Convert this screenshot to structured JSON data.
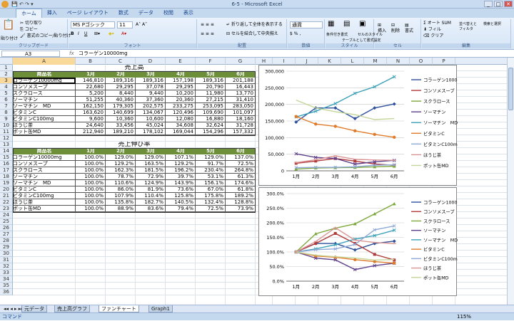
{
  "window": {
    "title": "6-5 - Microsoft Excel"
  },
  "ribbon_tabs": [
    "ホーム",
    "挿入",
    "ページ レイアウト",
    "数式",
    "データ",
    "校閲",
    "表示"
  ],
  "ribbon": {
    "paste": "貼り付け",
    "cut": "切り取り",
    "copy": "コピー",
    "format_painter": "書式のコピー/貼り付け",
    "font_name": "MS Pゴシック",
    "font_size": "11",
    "number_format": "通貨",
    "wrap": "折り返して全体を表示する",
    "merge": "セルを結合して中央揃え",
    "cond_format": "条件付き書式",
    "table_format": "テーブルとして書式設定",
    "cell_style": "セルのスタイル",
    "insert": "挿入",
    "delete": "削除",
    "format": "書式",
    "autosum": "オート SUM",
    "fill": "フィル",
    "clear": "クリア",
    "sort": "並べ替えとフィルタ",
    "find": "検索と選択",
    "groups": [
      "クリップボード",
      "フォント",
      "配置",
      "数値",
      "スタイル",
      "セル",
      "編集"
    ]
  },
  "formula_bar": {
    "name_box": "A3",
    "fx": "fx",
    "formula": "コラーゲン10000mg"
  },
  "columns": [
    "A",
    "B",
    "C",
    "D",
    "E",
    "F",
    "G",
    "H",
    "I",
    "J",
    "K",
    "L",
    "M",
    "N",
    "O",
    "P"
  ],
  "rows": [
    "1",
    "2",
    "3",
    "4",
    "5",
    "6",
    "7",
    "8",
    "9",
    "10",
    "11",
    "12",
    "13",
    "14",
    "15",
    "16",
    "17",
    "18",
    "19",
    "20",
    "21",
    "22",
    "23",
    "24",
    "25",
    "26",
    "27",
    "28",
    "29",
    "30",
    "31",
    "32",
    "33",
    "34",
    "35",
    "36"
  ],
  "table1": {
    "title": "売上高",
    "headers": [
      "商品名",
      "1月",
      "2月",
      "3月",
      "4月",
      "5月",
      "6月"
    ],
    "rows": [
      [
        "コラーゲン10000mg",
        "146,810",
        "189,316",
        "189,316",
        "157,198",
        "189,316",
        "201,188"
      ],
      [
        "コンソメスープ",
        "22,680",
        "29,295",
        "37,078",
        "29,295",
        "20,790",
        "16,443"
      ],
      [
        "スクラロース",
        "5,200",
        "8,440",
        "9,440",
        "10,200",
        "11,980",
        "13,770"
      ],
      [
        "ソーマチン",
        "51,255",
        "40,360",
        "37,360",
        "20,360",
        "27,215",
        "31,410"
      ],
      [
        "ソーマチン　MD",
        "162,150",
        "179,305",
        "202,575",
        "233,275",
        "253,095",
        "283,050"
      ],
      [
        "ビタミンC",
        "163,620",
        "140,699",
        "134,067",
        "120,496",
        "109,690",
        "101,097"
      ],
      [
        "ビタミンC100mg",
        "9,600",
        "10,360",
        "10,600",
        "12,080",
        "16,880",
        "18,160"
      ],
      [
        "ほうじ茶",
        "24,640",
        "33,456",
        "45,024",
        "34,608",
        "32,624",
        "31,728"
      ],
      [
        "ポット缶MD",
        "212,940",
        "189,210",
        "178,102",
        "169,044",
        "154,296",
        "157,332"
      ]
    ]
  },
  "table2": {
    "title": "売上伸び率",
    "headers": [
      "商品名",
      "1月",
      "2月",
      "3月",
      "4月",
      "5月",
      "6月"
    ],
    "rows": [
      [
        "コラーゲン10000mg",
        "100.0%",
        "129.0%",
        "129.0%",
        "107.1%",
        "129.0%",
        "137.0%"
      ],
      [
        "コンソメスープ",
        "100.0%",
        "129.2%",
        "163.5%",
        "129.2%",
        "91.7%",
        "72.5%"
      ],
      [
        "スクラロース",
        "100.0%",
        "162.3%",
        "181.5%",
        "196.2%",
        "230.4%",
        "264.8%"
      ],
      [
        "ソーマチン",
        "100.0%",
        "78.7%",
        "72.9%",
        "39.7%",
        "53.1%",
        "61.3%"
      ],
      [
        "ソーマチン　MD",
        "100.0%",
        "110.6%",
        "124.9%",
        "143.9%",
        "156.1%",
        "174.6%"
      ],
      [
        "ビタミンC",
        "100.0%",
        "86.0%",
        "81.9%",
        "73.6%",
        "67.0%",
        "61.8%"
      ],
      [
        "ビタミンC100mg",
        "100.0%",
        "107.9%",
        "110.4%",
        "125.8%",
        "175.8%",
        "189.2%"
      ],
      [
        "ほうじ茶",
        "100.0%",
        "135.8%",
        "182.7%",
        "140.5%",
        "132.4%",
        "128.8%"
      ],
      [
        "ポット缶MD",
        "100.0%",
        "88.9%",
        "83.6%",
        "79.4%",
        "72.5%",
        "73.9%"
      ]
    ]
  },
  "chart_data": [
    {
      "type": "line",
      "categories": [
        "1月",
        "2月",
        "3月",
        "4月",
        "5月",
        "6月"
      ],
      "ylim": [
        0,
        300000
      ],
      "yticks": [
        "0",
        "50,000",
        "100,000",
        "150,000",
        "200,000",
        "250,000",
        "300,000"
      ],
      "series": [
        {
          "name": "コラーゲン10000mg",
          "color": "#2e4f9a",
          "values": [
            146810,
            189316,
            189316,
            157198,
            189316,
            201188
          ]
        },
        {
          "name": "コンソメスープ",
          "color": "#b03a3a",
          "values": [
            22680,
            29295,
            37078,
            29295,
            20790,
            16443
          ]
        },
        {
          "name": "スクラロース",
          "color": "#7da83c",
          "values": [
            5200,
            8440,
            9440,
            10200,
            11980,
            13770
          ]
        },
        {
          "name": "ソーマチン",
          "color": "#5e3f8a",
          "values": [
            51255,
            40360,
            37360,
            20360,
            27215,
            31410
          ]
        },
        {
          "name": "ソーマチン　MD",
          "color": "#3aa0b8",
          "values": [
            162150,
            179305,
            202575,
            233275,
            253095,
            283050
          ]
        },
        {
          "name": "ビタミンC",
          "color": "#e07b2a",
          "values": [
            163620,
            140699,
            134067,
            120496,
            109690,
            101097
          ]
        },
        {
          "name": "ビタミンC100mg",
          "color": "#8fa9d8",
          "values": [
            9600,
            10360,
            10600,
            12080,
            16880,
            18160
          ]
        },
        {
          "name": "ほうじ茶",
          "color": "#d99494",
          "values": [
            24640,
            33456,
            45024,
            34608,
            32624,
            31728
          ]
        },
        {
          "name": "ポット缶MD",
          "color": "#c4d69a",
          "values": [
            212940,
            189210,
            178102,
            169044,
            154296,
            157332
          ]
        }
      ]
    },
    {
      "type": "line",
      "categories": [
        "1月",
        "2月",
        "3月",
        "4月",
        "5月",
        "6月"
      ],
      "ylim": [
        0,
        3
      ],
      "yticks": [
        "0.0%",
        "50.0%",
        "100.0%",
        "150.0%",
        "200.0%",
        "250.0%",
        "300.0%"
      ],
      "series": [
        {
          "name": "コラーゲン10000mg",
          "color": "#2e4f9a",
          "values": [
            1.0,
            1.29,
            1.29,
            1.071,
            1.29,
            1.37
          ]
        },
        {
          "name": "コンソメスープ",
          "color": "#b03a3a",
          "values": [
            1.0,
            1.292,
            1.635,
            1.292,
            0.917,
            0.725
          ]
        },
        {
          "name": "スクラロース",
          "color": "#7da83c",
          "values": [
            1.0,
            1.623,
            1.815,
            1.962,
            2.304,
            2.648
          ]
        },
        {
          "name": "ソーマチン",
          "color": "#5e3f8a",
          "values": [
            1.0,
            0.787,
            0.729,
            0.397,
            0.531,
            0.613
          ]
        },
        {
          "name": "ソーマチン　MD",
          "color": "#3aa0b8",
          "values": [
            1.0,
            1.106,
            1.249,
            1.439,
            1.561,
            1.746
          ]
        },
        {
          "name": "ビタミンC",
          "color": "#e07b2a",
          "values": [
            1.0,
            0.86,
            0.819,
            0.736,
            0.67,
            0.618
          ]
        },
        {
          "name": "ビタミンC100mg",
          "color": "#8fa9d8",
          "values": [
            1.0,
            1.079,
            1.104,
            1.258,
            1.758,
            1.892
          ]
        },
        {
          "name": "ほうじ茶",
          "color": "#d99494",
          "values": [
            1.0,
            1.358,
            1.827,
            1.405,
            1.324,
            1.288
          ]
        },
        {
          "name": "ポット缶MD",
          "color": "#c4d69a",
          "values": [
            1.0,
            0.889,
            0.836,
            0.794,
            0.725,
            0.739
          ]
        }
      ]
    }
  ],
  "sheet_tabs": [
    "元データ",
    "売上高グラフ",
    "ファンチャート",
    "Graph1"
  ],
  "status": {
    "mode": "コマンド",
    "zoom": "115%"
  }
}
